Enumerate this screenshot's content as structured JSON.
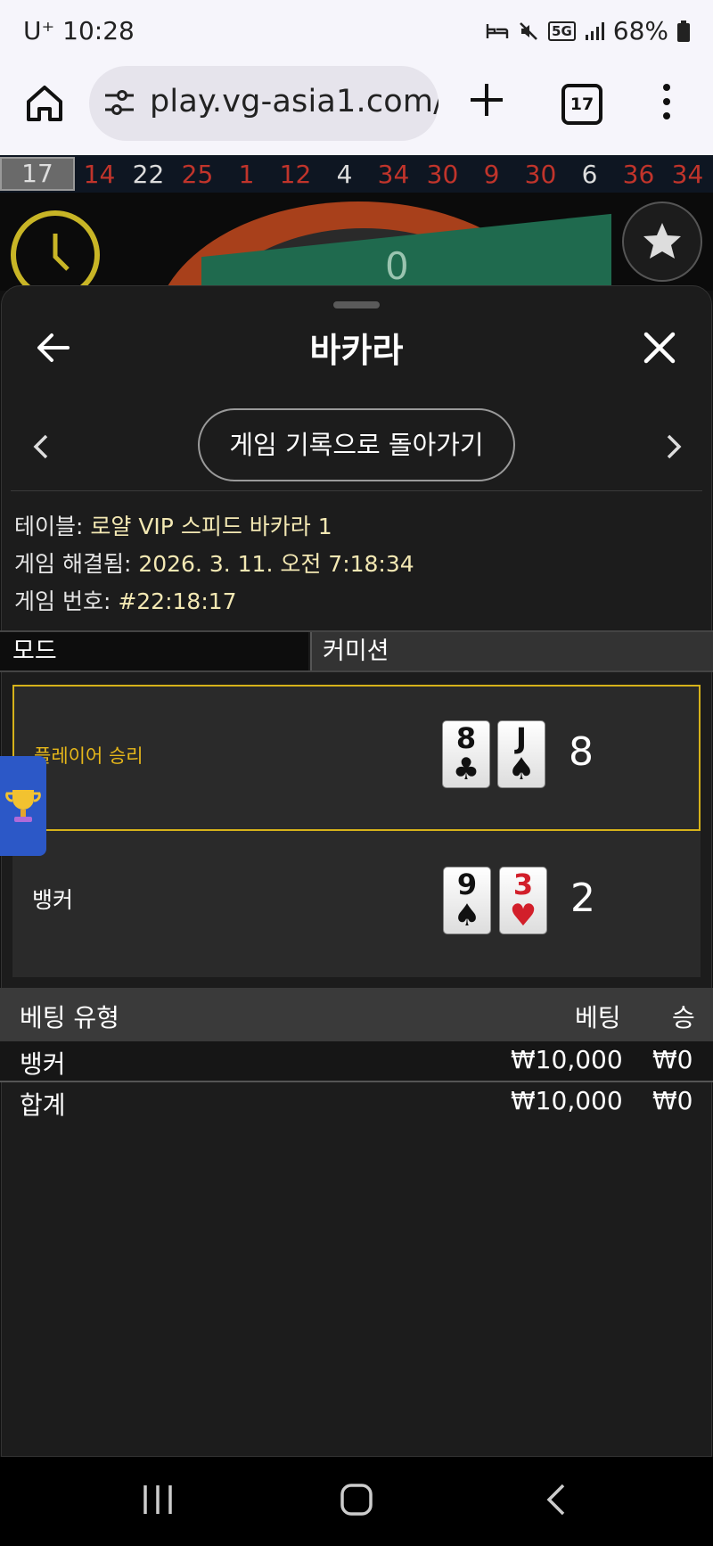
{
  "status_bar": {
    "carrier_time": "U⁺ 10:28",
    "battery": "68%",
    "network": "5G"
  },
  "browser": {
    "url": "play.vg-asia1.com/",
    "tab_count": "17"
  },
  "roulette_history": [
    {
      "n": "17",
      "c": "#9a9a9a"
    },
    {
      "n": "14",
      "c": "red"
    },
    {
      "n": "22",
      "c": "white"
    },
    {
      "n": "25",
      "c": "red"
    },
    {
      "n": "1",
      "c": "red"
    },
    {
      "n": "12",
      "c": "red"
    },
    {
      "n": "4",
      "c": "white"
    },
    {
      "n": "34",
      "c": "red"
    },
    {
      "n": "30",
      "c": "red"
    },
    {
      "n": "9",
      "c": "red"
    },
    {
      "n": "30",
      "c": "red"
    },
    {
      "n": "6",
      "c": "white"
    },
    {
      "n": "36",
      "c": "red"
    },
    {
      "n": "34",
      "c": "red"
    }
  ],
  "background": {
    "zero": "0"
  },
  "sheet": {
    "title": "바카라",
    "history_button": "게임 기록으로 돌아가기",
    "info": {
      "table_label": "테이블: ",
      "table_value": "로얄 VIP 스피드 바카라 1",
      "resolved_label": "게임 해결됨: ",
      "resolved_value": "2026. 3. 11. 오전 7:18:34",
      "number_label": "게임 번호: ",
      "number_value": "#22:18:17"
    },
    "mode": {
      "label": "모드",
      "value": "커미션"
    },
    "result": {
      "player": {
        "label": "플레이어 승리",
        "cards": [
          {
            "rank": "8",
            "suit": "♣",
            "color": "black"
          },
          {
            "rank": "J",
            "suit": "♠",
            "color": "black"
          }
        ],
        "score": "8"
      },
      "banker": {
        "label": "뱅커",
        "cards": [
          {
            "rank": "9",
            "suit": "♠",
            "color": "black"
          },
          {
            "rank": "3",
            "suit": "♥",
            "color": "red"
          }
        ],
        "score": "2"
      }
    },
    "bets": {
      "headers": {
        "type": "베팅 유형",
        "bet": "베팅",
        "win": "승"
      },
      "rows": [
        {
          "type": "뱅커",
          "bet": "₩10,000",
          "win": "₩0"
        }
      ],
      "total": {
        "type": "합계",
        "bet": "₩10,000",
        "win": "₩0"
      }
    }
  },
  "colors": {
    "accent_gold": "#d6b21a",
    "red_number": "#c0342b"
  }
}
